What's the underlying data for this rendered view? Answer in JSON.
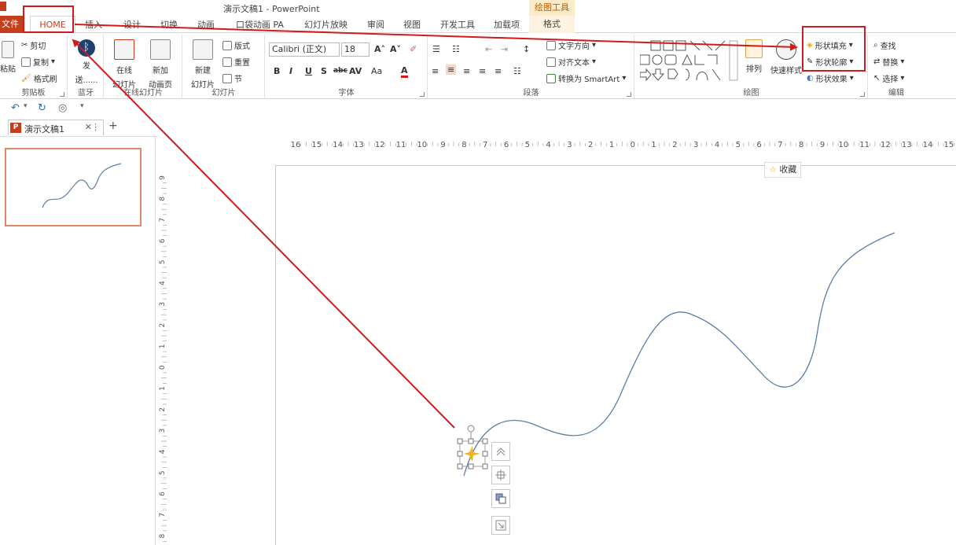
{
  "window": {
    "title": "演示文稿1 - PowerPoint",
    "context_group": "绘图工具"
  },
  "tabs": [
    "文件",
    "HOME",
    "插入",
    "设计",
    "切换",
    "动画",
    "口袋动画 PA",
    "幻灯片放映",
    "审阅",
    "视图",
    "开发工具",
    "加载项",
    "格式"
  ],
  "clipboard": {
    "paste": "粘贴",
    "cut": "剪切",
    "copy": "复制",
    "painter": "格式刷",
    "label": "剪贴板"
  },
  "bluetooth": {
    "send": "发",
    "send2": "送......",
    "label": "蓝牙"
  },
  "online": {
    "online_slide": "在线",
    "online_slide2": "幻灯片",
    "new_anim": "新加",
    "new_anim2": "动画页",
    "label": "在线幻灯片"
  },
  "slides": {
    "new_slide": "新建",
    "new_slide2": "幻灯片",
    "layout": "版式",
    "reset": "重置",
    "section": "节",
    "label": "幻灯片"
  },
  "font": {
    "name": "Calibri (正文)",
    "size": "18",
    "label": "字体"
  },
  "paragraph": {
    "text_direction": "文字方向",
    "align_text": "对齐文本",
    "smartart": "转换为 SmartArt",
    "label": "段落"
  },
  "drawing": {
    "arrange": "排列",
    "quick_styles": "快速样式",
    "shape_fill": "形状填充",
    "shape_outline": "形状轮廓",
    "shape_effects": "形状效果",
    "label": "绘图"
  },
  "editing": {
    "find": "查找",
    "replace": "替换",
    "select": "选择",
    "label": "编辑"
  },
  "doc_tab": {
    "name": "演示文稿1",
    "pp": "P"
  },
  "favorite": {
    "label": "收藏",
    "star": "☆"
  },
  "ruler_h_labels": [
    "16",
    "15",
    "14",
    "13",
    "12",
    "11",
    "10",
    "9",
    "8",
    "7",
    "6",
    "5",
    "4",
    "3",
    "2",
    "1",
    "0",
    "1",
    "2",
    "3",
    "4",
    "5",
    "6",
    "7",
    "8",
    "9",
    "10",
    "11",
    "12",
    "13",
    "14",
    "15"
  ],
  "ruler_v_labels": [
    "9",
    "8",
    "7",
    "6",
    "5",
    "4",
    "3",
    "2",
    "1",
    "0",
    "1",
    "2",
    "3",
    "4",
    "5",
    "6",
    "7",
    "8"
  ],
  "colors": {
    "accent": "#c43e1c",
    "highlight": "#d21a1a",
    "curve": "#5b7fa6",
    "arrow": "#d21a1a"
  }
}
